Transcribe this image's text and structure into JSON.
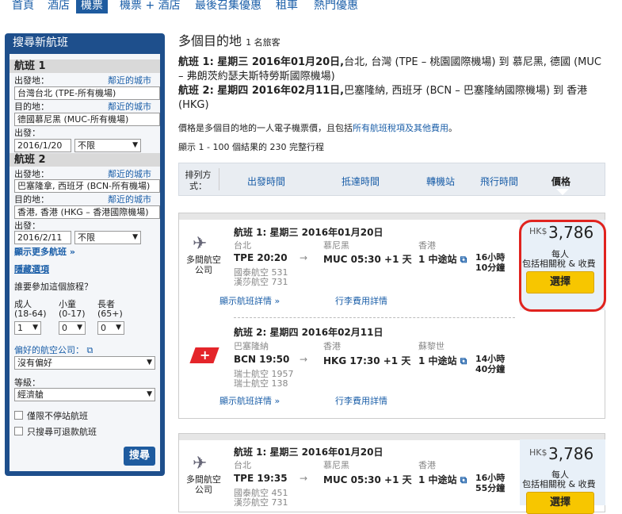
{
  "nav": {
    "tabs": [
      "首頁",
      "酒店",
      "機票",
      "機票 + 酒店",
      "最後召集優惠",
      "租車",
      "熱門優惠"
    ]
  },
  "sidebar": {
    "title": "搜尋新航班",
    "flight1": {
      "label": "航班 1",
      "from_label": "出發地：",
      "from_value": "台灣台北 (TPE-所有機場)",
      "to_label": "目的地：",
      "to_value": "德國慕尼黑 (MUC-所有機場)",
      "date_label": "出發：",
      "date_value": "2016/1/20",
      "time_value": "不限",
      "nearby": "鄰近的城市"
    },
    "flight2": {
      "label": "航班 2",
      "from_label": "出發地：",
      "from_value": "巴塞隆拿, 西班牙 (BCN-所有機場)",
      "to_label": "目的地：",
      "to_value": "香港, 香港 (HKG – 香港國際機場)",
      "date_label": "出發：",
      "date_value": "2016/2/11",
      "time_value": "不限",
      "nearby": "鄰近的城市"
    },
    "more_flights": "顯示更多航班",
    "hide_options": "隱藏選項",
    "who_question": "誰要參加這個旅程？",
    "adult_label": "成人",
    "adult_range": "(18-64)",
    "adult_value": "1",
    "child_label": "小童",
    "child_range": "(0-17)",
    "child_value": "0",
    "senior_label": "長者",
    "senior_range": "(65+)",
    "senior_value": "0",
    "airline_label": "偏好的航空公司：",
    "airline_value": "沒有偏好",
    "class_label": "等級：",
    "class_value": "經濟艙",
    "nonstop_label": "僅限不停站航班",
    "refundable_label": "只搜尋可退款航班",
    "search_button": "搜尋"
  },
  "main": {
    "title": "多個目的地",
    "travelers": "1 名旅客",
    "flight1_desc_bold": "航班 1: 星期三 2016年01月20日,",
    "flight1_desc": "台北, 台灣 (TPE – 桃園國際機場) 到 慕尼黑, 德國 (MUC – 弗朗茨約瑟夫斯特勞斯國際機場)",
    "flight2_desc_bold": "航班 2: 星期四 2016年02月11日,",
    "flight2_desc": "巴塞隆納, 西班牙 (BCN – 巴塞隆納國際機場) 到 香港 (HKG)",
    "price_note": "價格是多個目的地的一人電子機票價，且包括",
    "price_note_link": "所有航班稅項及其他費用",
    "price_note_end": "。",
    "results": "顯示 1 - 100 個結果的 230 完整行程",
    "sort_label": "排列方式：",
    "sort_cols": [
      "出發時間",
      "抵達時間",
      "轉機站",
      "飛行時間",
      "價格"
    ]
  },
  "results": [
    {
      "leg1": {
        "heading": "航班 1: 星期三 2016年01月20日",
        "dep_city": "台北",
        "arr_city": "慕尼黑",
        "stop_city": "香港",
        "dep": "TPE 20:20",
        "arr": "MUC 05:30 +1 天",
        "stops": "1 中途站",
        "duration": "16小時 10分鐘",
        "carrier1": "國泰航空 531",
        "carrier2": "漢莎航空 731",
        "airline_name": "多間航空公司"
      },
      "leg2": {
        "heading": "航班 2: 星期四 2016年02月11日",
        "dep_city": "巴塞隆納",
        "arr_city": "香港",
        "stop_city": "蘇黎世",
        "dep": "BCN 19:50",
        "arr": "HKG 17:30 +1 天",
        "stops": "1 中途站",
        "duration": "14小時 40分鐘",
        "carrier1": "瑞士航空 1957",
        "carrier2": "瑞士航空 138"
      },
      "currency": "HK$",
      "price": "3,786",
      "per_person": "每人",
      "incl": "包括相關稅 & 收費",
      "select": "選擇",
      "details_link": "顯示航班詳情",
      "fees_link": "行李費用詳情"
    },
    {
      "leg1": {
        "heading": "航班 1: 星期三 2016年01月20日",
        "dep_city": "台北",
        "arr_city": "慕尼黑",
        "stop_city": "香港",
        "dep": "TPE 19:35",
        "arr": "MUC 05:30 +1 天",
        "stops": "1 中途站",
        "duration": "16小時 55分鐘",
        "carrier1": "國泰航空 451",
        "carrier2": "漢莎航空 731",
        "airline_name": "多間航空公司"
      },
      "currency": "HK$",
      "price": "3,786",
      "per_person": "每人",
      "incl": "包括相關稅 & 收費",
      "select": "選擇"
    }
  ]
}
